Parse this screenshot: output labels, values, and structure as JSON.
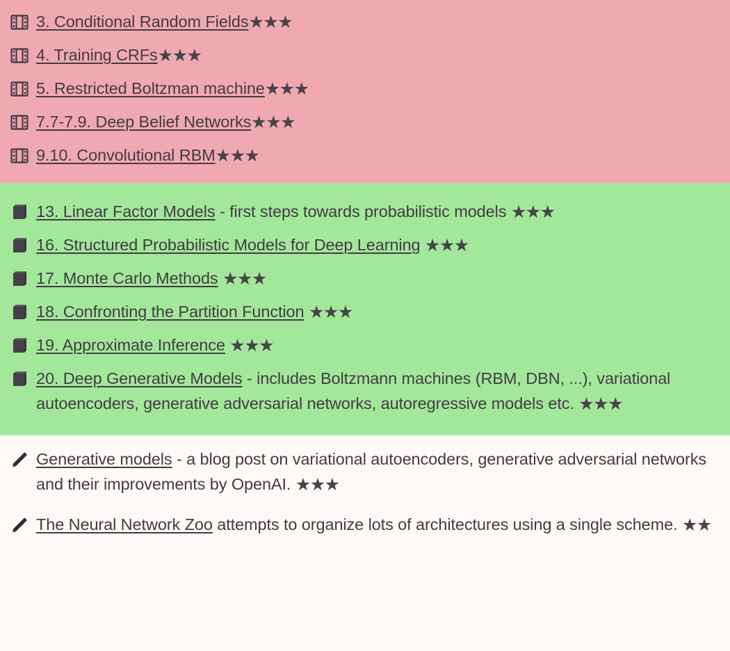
{
  "sections": [
    {
      "name": "video-lectures-section",
      "background": "#f0a9b2",
      "icon": "film-icon",
      "items": [
        {
          "link": "3. Conditional Random Fields",
          "desc": "",
          "stars": "★★★",
          "star_count": 3
        },
        {
          "link": "4. Training CRFs",
          "desc": "",
          "stars": "★★★",
          "star_count": 3
        },
        {
          "link": "5. Restricted Boltzman machine",
          "desc": "",
          "stars": "★★★",
          "star_count": 3
        },
        {
          "link": "7.7-7.9. Deep Belief Networks",
          "desc": "",
          "stars": "★★★",
          "star_count": 3
        },
        {
          "link": "9.10. Convolutional RBM",
          "desc": "",
          "stars": "★★★",
          "star_count": 3
        }
      ]
    },
    {
      "name": "book-chapters-section",
      "background": "#a3e79b",
      "icon": "book-icon",
      "items": [
        {
          "link": "13. Linear Factor Models",
          "desc": " - first steps towards probabilistic models ",
          "stars": "★★★",
          "star_count": 3
        },
        {
          "link": "16. Structured Probabilistic Models for Deep Learning",
          "desc": " ",
          "stars": "★★★",
          "star_count": 3
        },
        {
          "link": "17. Monte Carlo Methods",
          "desc": " ",
          "stars": "★★★",
          "star_count": 3
        },
        {
          "link": "18. Confronting the Partition Function",
          "desc": " ",
          "stars": "★★★",
          "star_count": 3
        },
        {
          "link": "19. Approximate Inference",
          "desc": " ",
          "stars": "★★★",
          "star_count": 3
        },
        {
          "link": "20. Deep Generative Models",
          "desc": " - includes Boltzmann machines (RBM, DBN, ...), variational autoencoders, generative adversarial networks, autoregressive models etc. ",
          "stars": "★★★",
          "star_count": 3
        }
      ]
    },
    {
      "name": "blog-posts-section",
      "background": "#fdf9f6",
      "icon": "pencil-icon",
      "items": [
        {
          "link": "Generative models",
          "desc": " - a blog post on variational autoencoders, generative adversarial networks and their improvements by OpenAI. ",
          "stars": "★★★",
          "star_count": 3
        },
        {
          "link": "The Neural Network Zoo",
          "desc": " attempts to organize lots of architectures using a single scheme. ",
          "stars": "★★",
          "star_count": 2
        }
      ]
    }
  ],
  "colors": {
    "pink": "#f0a9b2",
    "green": "#a3e79b",
    "cream": "#fdf9f6",
    "text": "#413c42",
    "star": "#47434a"
  }
}
